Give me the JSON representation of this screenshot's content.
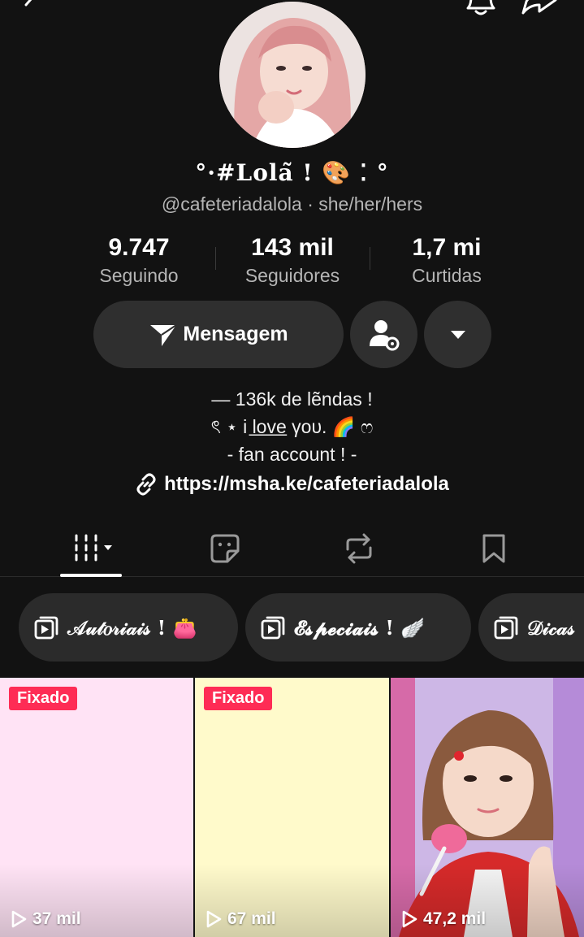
{
  "profile": {
    "display_name": "°·#𝐋𝐨𝐥𝐚̃ ! 🎨 ⁚ °",
    "handle_line": "@cafeteriadalola · she/her/hers"
  },
  "stats": [
    {
      "value": "9.747",
      "label": "Seguindo"
    },
    {
      "value": "143 mil",
      "label": "Seguidores"
    },
    {
      "value": "1,7 mi",
      "label": "Curtidas"
    }
  ],
  "actions": {
    "message_label": "Mensagem"
  },
  "bio": {
    "line1": "— 136k de lẽndas !",
    "line2": "ৎ ⋆ i l̲o̲v̲e̲ γου. 🌈 ෆ",
    "line3": "- fan account ! -",
    "link": "https://msha.ke/cafeteriadalola"
  },
  "playlists": [
    {
      "label": "𝒜𝓊𝓉𝑜𝓇𝒾𝒶𝒾𝓈 ! 👛"
    },
    {
      "label": "𝓔𝓼𝓹𝓮𝓬𝓲𝓪𝓲𝓼 ! 🪽"
    },
    {
      "label": "𝒟𝒾𝒸𝒶𝓈"
    }
  ],
  "videos": [
    {
      "badge": "Fixado",
      "views": "37 mil",
      "bg": "#ffe3f5"
    },
    {
      "badge": "Fixado",
      "views": "67 mil",
      "bg": "#fffacb"
    },
    {
      "views": "47,2 mil",
      "bg": "#c83a3a"
    }
  ],
  "colors": {
    "background": "#121212",
    "button": "#2f2f2f",
    "badge": "#fe2c55",
    "muted_text": "#b5b5b5"
  }
}
